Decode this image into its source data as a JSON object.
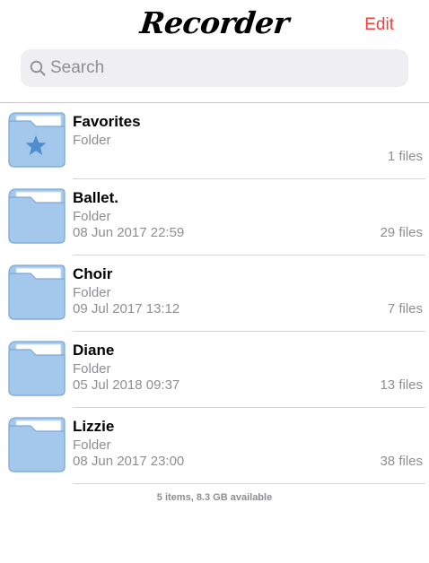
{
  "header": {
    "title": "Recorder",
    "edit_label": "Edit",
    "accent_color": "#f0413f"
  },
  "search": {
    "placeholder": "Search",
    "value": "",
    "icon": "magnifier-icon"
  },
  "folders": [
    {
      "name": "Favorites",
      "type": "Folder",
      "date": "",
      "count": "1 files",
      "icon": "folder-star-icon"
    },
    {
      "name": "Ballet.",
      "type": "Folder",
      "date": "08 Jun 2017 22:59",
      "count": "29 files",
      "icon": "folder-icon"
    },
    {
      "name": "Choir",
      "type": "Folder",
      "date": "09 Jul 2017 13:12",
      "count": "7 files",
      "icon": "folder-icon"
    },
    {
      "name": "Diane",
      "type": "Folder",
      "date": "05 Jul 2018 09:37",
      "count": "13 files",
      "icon": "folder-icon"
    },
    {
      "name": "Lizzie",
      "type": "Folder",
      "date": "08 Jun 2017 23:00",
      "count": "38 files",
      "icon": "folder-icon"
    }
  ],
  "footer": {
    "storage_text": "5 items, 8.3 GB available"
  },
  "colors": {
    "folder_fill": "#a4c8ec",
    "folder_stroke": "#7ba9d6",
    "star_fill": "#4f8fcf"
  }
}
